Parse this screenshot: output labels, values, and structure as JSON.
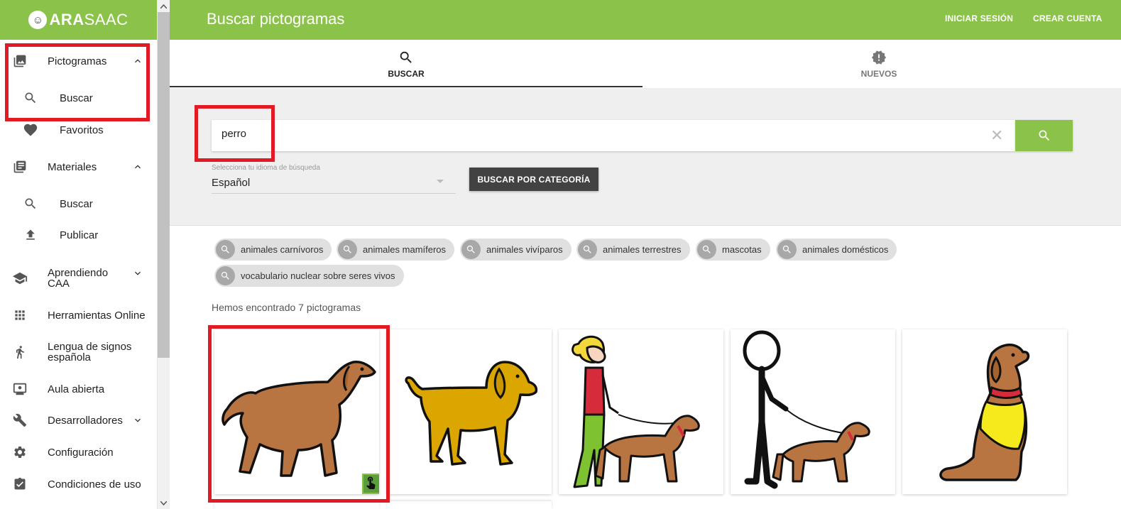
{
  "app": {
    "logo_bold": "ARA",
    "logo_rest": "SAAC"
  },
  "header": {
    "title": "Buscar pictogramas",
    "login": "INICIAR SESIÓN",
    "register": "CREAR CUENTA"
  },
  "sidebar": {
    "pictogramas": "Pictogramas",
    "picto_buscar": "Buscar",
    "favoritos": "Favoritos",
    "materiales": "Materiales",
    "mat_buscar": "Buscar",
    "publicar": "Publicar",
    "aprendiendo": "Aprendiendo",
    "aprendiendo2": "CAA",
    "herramientas": "Herramientas Online",
    "lengua": "Lengua de signos",
    "lengua2": "española",
    "aula": "Aula abierta",
    "desarrolladores": "Desarrolladores",
    "configuracion": "Configuración",
    "condiciones": "Condiciones de uso"
  },
  "tabs": {
    "buscar": "BUSCAR",
    "nuevos": "NUEVOS"
  },
  "search": {
    "value": "perro",
    "lang_label": "Selecciona tu idioma de búsqueda",
    "lang_value": "Español",
    "category_button": "BUSCAR POR CATEGORÍA"
  },
  "chips": [
    "animales carnívoros",
    "animales mamíferos",
    "animales vivíparos",
    "animales terrestres",
    "mascotas",
    "animales domésticos",
    "vocabulario nuclear sobre seres vivos"
  ],
  "results": {
    "summary": "Hemos encontrado 7 pictogramas"
  },
  "colors": {
    "brand_green": "#8bc34a",
    "highlight_red": "#e01b24",
    "dark_button": "#424242"
  },
  "icons": [
    "search-icon",
    "photo-library-icon",
    "heart-icon",
    "library-books-icon",
    "upload-icon",
    "school-icon",
    "apps-grid-icon",
    "sign-language-icon",
    "classroom-icon",
    "wrench-icon",
    "gear-icon",
    "assignment-check-icon",
    "new-releases-icon",
    "close-icon",
    "touch-icon"
  ]
}
